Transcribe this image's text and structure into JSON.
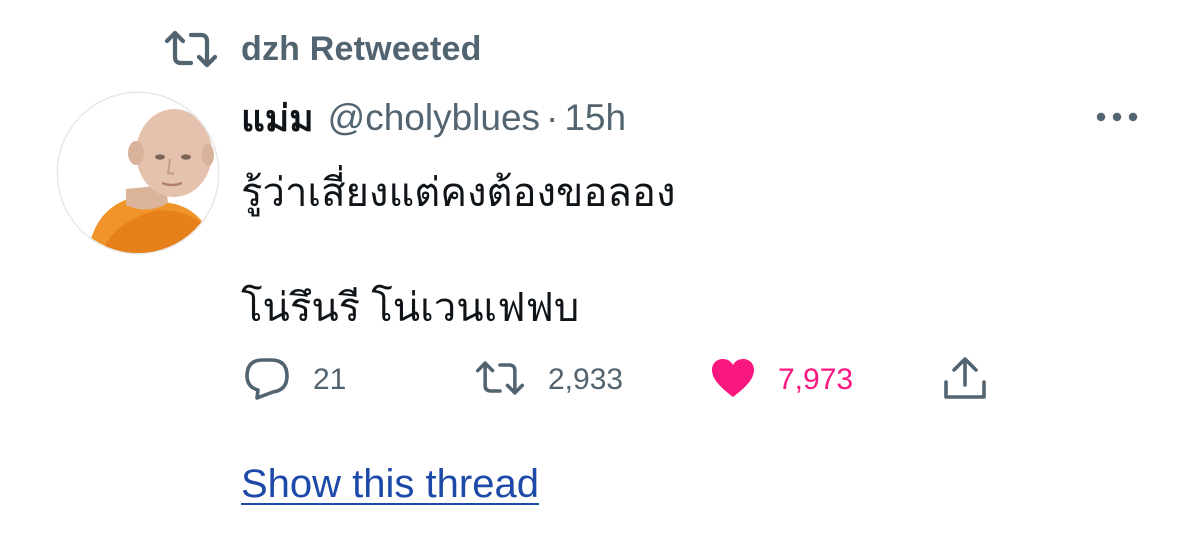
{
  "retweet_context": {
    "icon": "retweet-icon",
    "label": "dzh Retweeted"
  },
  "author": {
    "display_name": "แม่ม",
    "handle": "@cholyblues",
    "separator": "·",
    "time": "15h",
    "avatar": "monk-avatar"
  },
  "tweet": {
    "line1": "รู้ว่าเสี่ยงแต่คงต้องขอลอง",
    "line2": "โน่รึนรี  โน่เวนเฟฟบ"
  },
  "actions": {
    "reply": {
      "icon": "reply-icon",
      "count": "21"
    },
    "retweet": {
      "icon": "retweet-icon",
      "count": "2,933"
    },
    "like": {
      "icon": "heart-icon",
      "count": "7,973",
      "color": "#f91880"
    },
    "share": {
      "icon": "share-icon"
    }
  },
  "more_icon": "more-icon",
  "show_thread": "Show this thread",
  "colors": {
    "text": "#0f1419",
    "secondary": "#536471",
    "link": "#1d4aa8",
    "like": "#f91880"
  }
}
